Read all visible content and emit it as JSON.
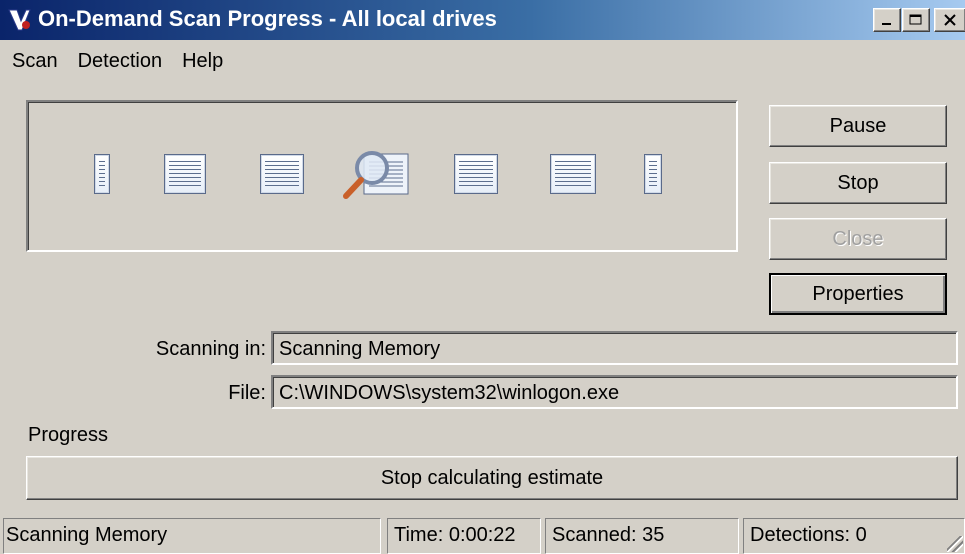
{
  "window": {
    "title": "On-Demand Scan Progress - All local drives"
  },
  "menu": {
    "items": [
      "Scan",
      "Detection",
      "Help"
    ]
  },
  "buttons": {
    "pause": "Pause",
    "stop": "Stop",
    "close": "Close",
    "properties": "Properties"
  },
  "fields": {
    "scanning_in_label": "Scanning in:",
    "scanning_in_value": "Scanning Memory",
    "file_label": "File:",
    "file_value": "C:\\WINDOWS\\system32\\winlogon.exe"
  },
  "progress": {
    "label": "Progress",
    "button": "Stop calculating estimate"
  },
  "status": {
    "message": "Scanning Memory",
    "time": "Time: 0:00:22",
    "scanned": "Scanned: 35",
    "detections": "Detections: 0"
  },
  "icons": {
    "app": "shield-logo-icon",
    "scan_animation": [
      "document-icon",
      "document-icon",
      "document-icon",
      "magnifier-icon",
      "document-icon",
      "document-icon",
      "document-icon"
    ]
  },
  "colors": {
    "titlebar_start": "#0a246a",
    "titlebar_end": "#a6caf0",
    "face": "#d4d0c8"
  }
}
